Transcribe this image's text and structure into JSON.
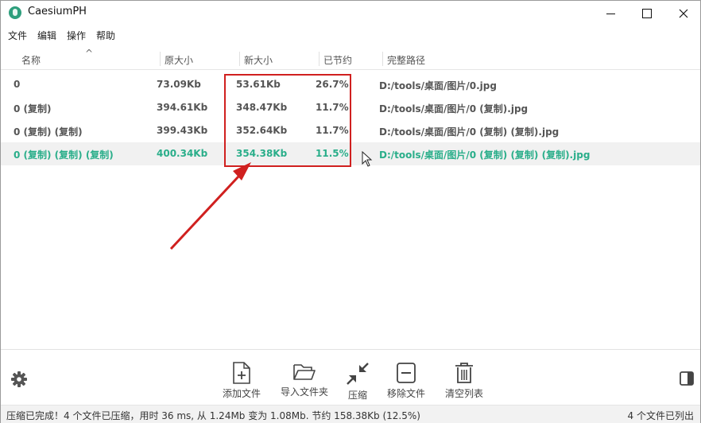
{
  "window": {
    "title": "CaesiumPH",
    "minimize_icon": "minimize-icon",
    "maximize_icon": "maximize-icon",
    "close_icon": "close-icon"
  },
  "menu": [
    "文件",
    "编辑",
    "操作",
    "帮助"
  ],
  "table": {
    "columns": [
      "名称",
      "原大小",
      "新大小",
      "已节约",
      "完整路径"
    ],
    "sort_indicator": "^",
    "rows": [
      {
        "name": "0",
        "original": "73.09Kb",
        "new": "53.61Kb",
        "saved": "26.7%",
        "path": "D:/tools/桌面/图片/0.jpg"
      },
      {
        "name": "0 (复制)",
        "original": "394.61Kb",
        "new": "348.47Kb",
        "saved": "11.7%",
        "path": "D:/tools/桌面/图片/0 (复制).jpg"
      },
      {
        "name": "0 (复制) (复制)",
        "original": "399.43Kb",
        "new": "352.64Kb",
        "saved": "11.7%",
        "path": "D:/tools/桌面/图片/0 (复制) (复制).jpg"
      },
      {
        "name": "0 (复制) (复制) (复制)",
        "original": "400.34Kb",
        "new": "354.38Kb",
        "saved": "11.5%",
        "path": "D:/tools/桌面/图片/0 (复制) (复制) (复制).jpg"
      }
    ],
    "selected_row": 3
  },
  "toolbar": {
    "add_file": "添加文件",
    "import_folder": "导入文件夹",
    "compress": "压缩",
    "remove_file": "移除文件",
    "clear_list": "清空列表"
  },
  "status": {
    "message": "压缩已完成！4 个文件已压缩，用时 36 ms, 从 1.24Mb 变为 1.08Mb. 节约 158.38Kb (12.5%)",
    "count": "4 个文件已列出"
  },
  "colors": {
    "accent": "#2aae8a",
    "annotation": "#d0201f"
  }
}
